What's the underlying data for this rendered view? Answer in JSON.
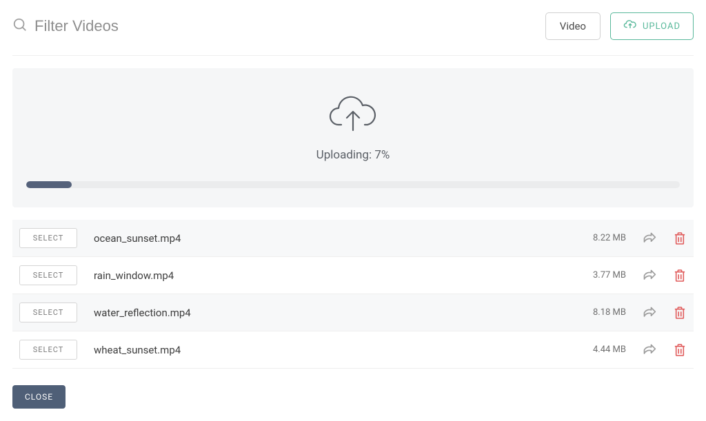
{
  "header": {
    "search_placeholder": "Filter Videos",
    "video_button": "Video",
    "upload_button": "UPLOAD"
  },
  "upload": {
    "label_prefix": "Uploading: ",
    "percent": 7,
    "label_suffix": "%"
  },
  "files": [
    {
      "name": "ocean_sunset.mp4",
      "size": "8.22 MB",
      "select_label": "SELECT"
    },
    {
      "name": "rain_window.mp4",
      "size": "3.77 MB",
      "select_label": "SELECT"
    },
    {
      "name": "water_reflection.mp4",
      "size": "8.18 MB",
      "select_label": "SELECT"
    },
    {
      "name": "wheat_sunset.mp4",
      "size": "4.44 MB",
      "select_label": "SELECT"
    }
  ],
  "footer": {
    "close_label": "CLOSE"
  },
  "colors": {
    "accent_green": "#58b89a",
    "progress_fill": "#54617a",
    "danger": "#e05a5a"
  }
}
